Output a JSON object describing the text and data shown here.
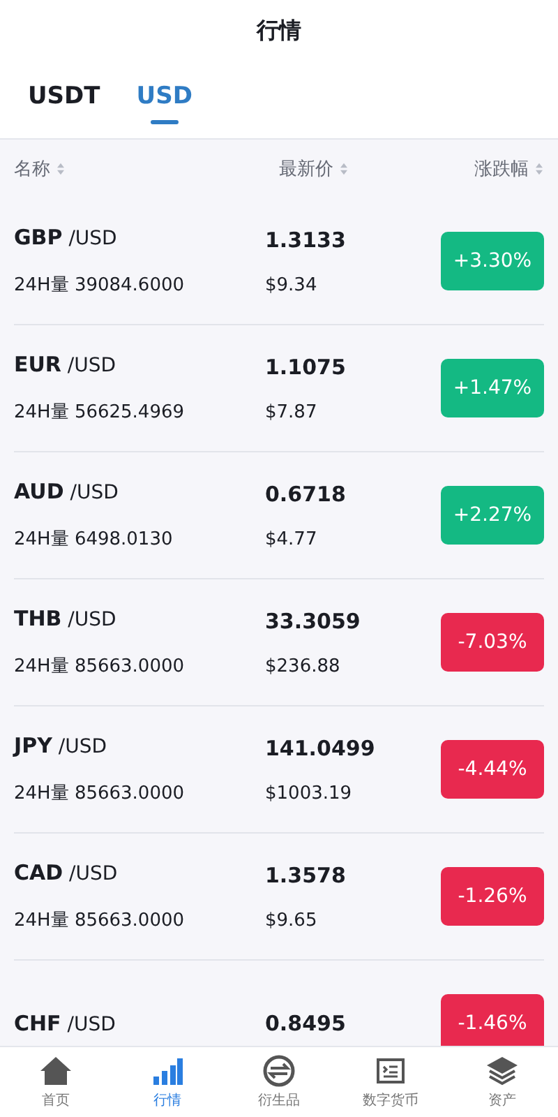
{
  "header": {
    "title": "行情"
  },
  "tabs": [
    {
      "label": "USDT",
      "selected": false
    },
    {
      "label": "USD",
      "selected": true
    }
  ],
  "columns": [
    {
      "label": "名称"
    },
    {
      "label": "最新价"
    },
    {
      "label": "涨跌幅"
    }
  ],
  "rows": [
    {
      "base": "GBP",
      "quote": "/USD",
      "volume": "24H量 39084.6000",
      "price": "1.3133",
      "usd": "$9.34",
      "change": "+3.30%",
      "kind": "up"
    },
    {
      "base": "EUR",
      "quote": "/USD",
      "volume": "24H量 56625.4969",
      "price": "1.1075",
      "usd": "$7.87",
      "change": "+1.47%",
      "kind": "up"
    },
    {
      "base": "AUD",
      "quote": "/USD",
      "volume": "24H量 6498.0130",
      "price": "0.6718",
      "usd": "$4.77",
      "change": "+2.27%",
      "kind": "up"
    },
    {
      "base": "THB",
      "quote": "/USD",
      "volume": "24H量 85663.0000",
      "price": "33.3059",
      "usd": "$236.88",
      "change": "-7.03%",
      "kind": "down"
    },
    {
      "base": "JPY",
      "quote": "/USD",
      "volume": "24H量 85663.0000",
      "price": "141.0499",
      "usd": "$1003.19",
      "change": "-4.44%",
      "kind": "down"
    },
    {
      "base": "CAD",
      "quote": "/USD",
      "volume": "24H量 85663.0000",
      "price": "1.3578",
      "usd": "$9.65",
      "change": "-1.26%",
      "kind": "down"
    },
    {
      "base": "CHF",
      "quote": "/USD",
      "price": "0.8495",
      "change": "-1.46%",
      "kind": "down"
    }
  ],
  "nav": [
    {
      "label": "首页",
      "kind": "home",
      "selected": false
    },
    {
      "label": "行情",
      "kind": "chart",
      "selected": true
    },
    {
      "label": "衍生品",
      "kind": "swap",
      "selected": false
    },
    {
      "label": "数字货币",
      "kind": "doc",
      "selected": false
    },
    {
      "label": "资产",
      "kind": "layers",
      "selected": false
    }
  ]
}
